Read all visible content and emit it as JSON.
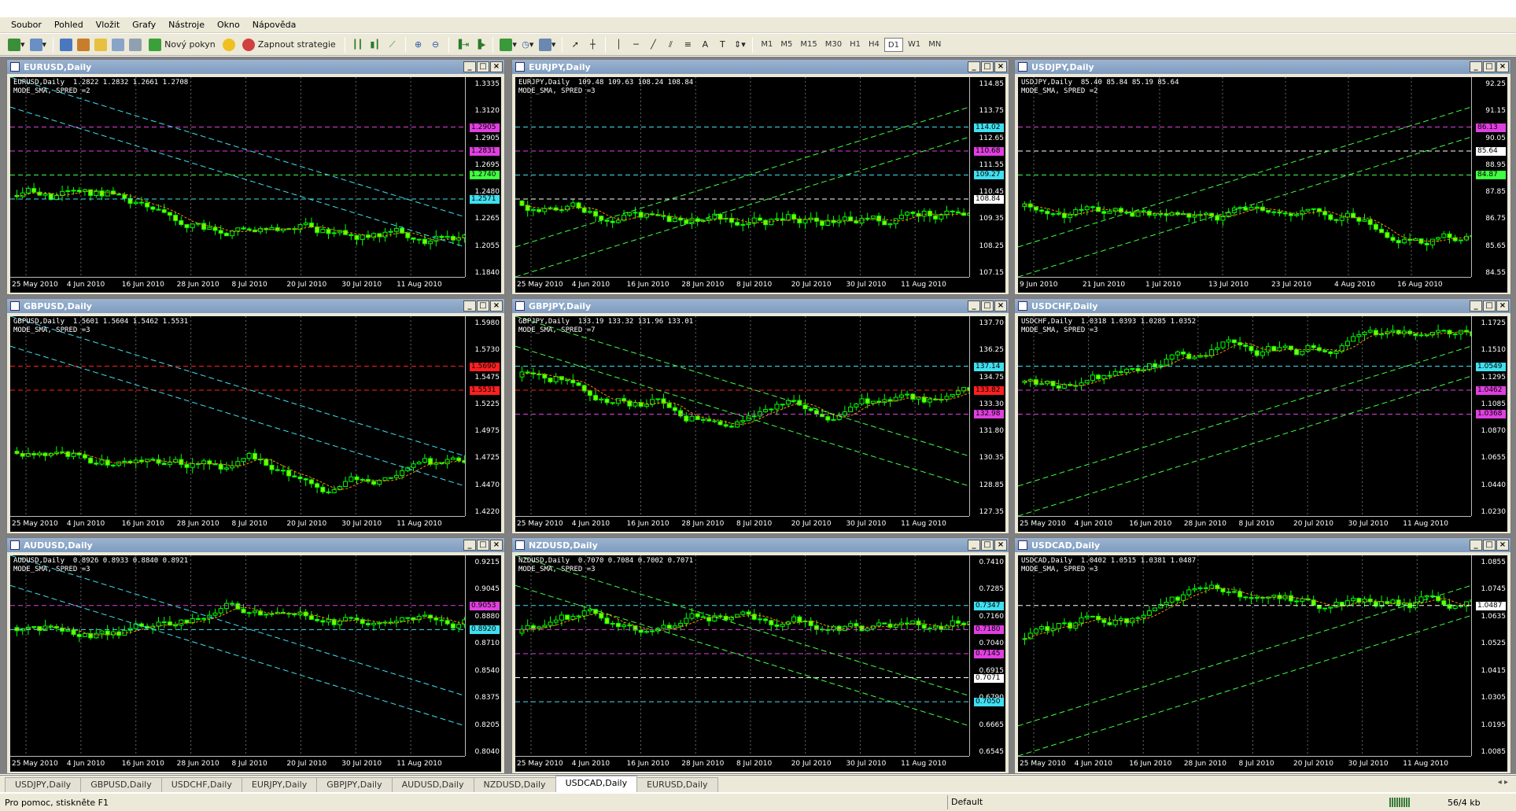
{
  "menu": [
    "Soubor",
    "Pohled",
    "Vložit",
    "Grafy",
    "Nástroje",
    "Okno",
    "Nápověda"
  ],
  "toolbar": {
    "new_order": "Nový pokyn",
    "autotrading": "Zapnout strategie",
    "timeframes": [
      "M1",
      "M5",
      "M15",
      "M30",
      "H1",
      "H4",
      "D1",
      "W1",
      "MN"
    ],
    "active_timeframe": "D1"
  },
  "colors": {
    "bull": "#000000",
    "bear": "#7CFC00",
    "candle_edge": "#00ff00",
    "grid": "#444444",
    "ma": "#ff8c00",
    "cyan": "#40e0f0",
    "magenta": "#e040e0",
    "green": "#40ff40"
  },
  "windows": [
    {
      "title": "EURUSD,Daily",
      "info1": "EURUSD,Daily  1.2822 1.2832 1.2661 1.2708",
      "info2": "MODE_SMA, SPRED =2",
      "prices": [
        "1.3335",
        "1.3120",
        "1.2905",
        "1.2695",
        "1.2480",
        "1.2265",
        "1.2055",
        "1.1840"
      ],
      "labels": [
        {
          "v": "1.2905",
          "c": "#e040e0"
        },
        {
          "v": "1.2831",
          "c": "#e040e0"
        },
        {
          "v": "1.2740",
          "c": "#40ff40"
        },
        {
          "v": "1.2571",
          "c": "#40e0f0"
        }
      ],
      "dates": [
        "25 May 2010",
        "4 Jun 2010",
        "16 Jun 2010",
        "28 Jun 2010",
        "8 Jul 2010",
        "20 Jul 2010",
        "30 Jul 2010",
        "11 Aug 2010"
      ]
    },
    {
      "title": "EURJPY,Daily",
      "info1": "EURJPY,Daily  109.48 109.63 108.24 108.84",
      "info2": "MODE_SMA, SPRED =3",
      "prices": [
        "114.85",
        "113.75",
        "112.65",
        "111.55",
        "110.45",
        "109.35",
        "108.25",
        "107.15"
      ],
      "labels": [
        {
          "v": "114.02",
          "c": "#40e0f0"
        },
        {
          "v": "110.68",
          "c": "#e040e0"
        },
        {
          "v": "109.27",
          "c": "#40e0f0"
        },
        {
          "v": "108.84",
          "c": "#ffffff"
        }
      ],
      "dates": [
        "25 May 2010",
        "4 Jun 2010",
        "16 Jun 2010",
        "28 Jun 2010",
        "8 Jul 2010",
        "20 Jul 2010",
        "30 Jul 2010",
        "11 Aug 2010"
      ]
    },
    {
      "title": "USDJPY,Daily",
      "info1": "USDJPY,Daily  85.40 85.84 85.19 85.64",
      "info2": "MODE_SMA, SPRED =2",
      "prices": [
        "92.25",
        "91.15",
        "90.05",
        "88.95",
        "87.85",
        "86.75",
        "85.65",
        "84.55"
      ],
      "labels": [
        {
          "v": "86.13",
          "c": "#e040e0"
        },
        {
          "v": "85.64",
          "c": "#ffffff"
        },
        {
          "v": "84.87",
          "c": "#40ff40"
        }
      ],
      "dates": [
        "9 Jun 2010",
        "21 Jun 2010",
        "1 Jul 2010",
        "13 Jul 2010",
        "23 Jul 2010",
        "4 Aug 2010",
        "16 Aug 2010"
      ]
    },
    {
      "title": "GBPUSD,Daily",
      "info1": "GBPUSD,Daily  1.5601 1.5604 1.5462 1.5531",
      "info2": "MODE_SMA, SPRED =3",
      "prices": [
        "1.5980",
        "1.5730",
        "1.5475",
        "1.5225",
        "1.4975",
        "1.4725",
        "1.4470",
        "1.4220"
      ],
      "labels": [
        {
          "v": "1.5690",
          "c": "#ff2020"
        },
        {
          "v": "1.5531",
          "c": "#ff2020"
        }
      ],
      "dates": [
        "25 May 2010",
        "4 Jun 2010",
        "16 Jun 2010",
        "28 Jun 2010",
        "8 Jul 2010",
        "20 Jul 2010",
        "30 Jul 2010",
        "11 Aug 2010"
      ]
    },
    {
      "title": "GBPJPY,Daily",
      "info1": "GBPJPY,Daily  133.19 133.32 131.96 133.01",
      "info2": "MODE_SMA, SPRED =7",
      "prices": [
        "137.70",
        "136.25",
        "134.75",
        "133.30",
        "131.80",
        "130.35",
        "128.85",
        "127.35"
      ],
      "labels": [
        {
          "v": "137.14",
          "c": "#40e0f0"
        },
        {
          "v": "133.82",
          "c": "#ff2020"
        },
        {
          "v": "132.98",
          "c": "#e040e0"
        }
      ],
      "dates": [
        "25 May 2010",
        "4 Jun 2010",
        "16 Jun 2010",
        "28 Jun 2010",
        "8 Jul 2010",
        "20 Jul 2010",
        "30 Jul 2010",
        "11 Aug 2010"
      ]
    },
    {
      "title": "USDCHF,Daily",
      "info1": "USDCHF,Daily  1.0318 1.0393 1.0285 1.0352",
      "info2": "MODE_SMA, SPRED =3",
      "prices": [
        "1.1725",
        "1.1510",
        "1.1295",
        "1.1085",
        "1.0870",
        "1.0655",
        "1.0440",
        "1.0230"
      ],
      "labels": [
        {
          "v": "1.0549",
          "c": "#40e0f0"
        },
        {
          "v": "1.0462",
          "c": "#e040e0"
        },
        {
          "v": "1.0368",
          "c": "#e040e0"
        }
      ],
      "dates": [
        "25 May 2010",
        "4 Jun 2010",
        "16 Jun 2010",
        "28 Jun 2010",
        "8 Jul 2010",
        "20 Jul 2010",
        "30 Jul 2010",
        "11 Aug 2010"
      ]
    },
    {
      "title": "AUDUSD,Daily",
      "info1": "AUDUSD,Daily  0.8926 0.8933 0.8840 0.8921",
      "info2": "MODE_SMA, SPRED =3",
      "prices": [
        "0.9215",
        "0.9045",
        "0.8880",
        "0.8710",
        "0.8540",
        "0.8375",
        "0.8205",
        "0.8040"
      ],
      "labels": [
        {
          "v": "0.9053",
          "c": "#e040e0"
        },
        {
          "v": "0.8920",
          "c": "#40e0f0"
        }
      ],
      "dates": [
        "25 May 2010",
        "4 Jun 2010",
        "16 Jun 2010",
        "28 Jun 2010",
        "8 Jul 2010",
        "20 Jul 2010",
        "30 Jul 2010",
        "11 Aug 2010"
      ]
    },
    {
      "title": "NZDUSD,Daily",
      "info1": "NZDUSD,Daily  0.7070 0.7084 0.7002 0.7071",
      "info2": "MODE_SMA, SPRED =3",
      "prices": [
        "0.7410",
        "0.7285",
        "0.7160",
        "0.7040",
        "0.6915",
        "0.6790",
        "0.6665",
        "0.6545"
      ],
      "labels": [
        {
          "v": "0.7347",
          "c": "#40e0f0"
        },
        {
          "v": "0.7180",
          "c": "#e040e0"
        },
        {
          "v": "0.7145",
          "c": "#e040e0"
        },
        {
          "v": "0.7071",
          "c": "#ffffff"
        },
        {
          "v": "0.7050",
          "c": "#40e0f0"
        }
      ],
      "dates": [
        "25 May 2010",
        "4 Jun 2010",
        "16 Jun 2010",
        "28 Jun 2010",
        "8 Jul 2010",
        "20 Jul 2010",
        "30 Jul 2010",
        "11 Aug 2010"
      ]
    },
    {
      "title": "USDCAD,Daily",
      "info1": "USDCAD,Daily  1.0402 1.0515 1.0381 1.0487",
      "info2": "MODE_SMA, SPRED =3",
      "prices": [
        "1.0855",
        "1.0745",
        "1.0635",
        "1.0525",
        "1.0415",
        "1.0305",
        "1.0195",
        "1.0085"
      ],
      "labels": [
        {
          "v": "1.0487",
          "c": "#ffffff"
        }
      ],
      "dates": [
        "25 May 2010",
        "4 Jun 2010",
        "16 Jun 2010",
        "28 Jun 2010",
        "8 Jul 2010",
        "20 Jul 2010",
        "30 Jul 2010",
        "11 Aug 2010"
      ]
    }
  ],
  "tabs": [
    "USDJPY,Daily",
    "GBPUSD,Daily",
    "USDCHF,Daily",
    "EURJPY,Daily",
    "GBPJPY,Daily",
    "AUDUSD,Daily",
    "NZDUSD,Daily",
    "USDCAD,Daily",
    "EURUSD,Daily"
  ],
  "active_tab": "USDCAD,Daily",
  "status": {
    "help": "Pro pomoc, stiskněte F1",
    "profile": "Default",
    "traffic": "56/4 kb"
  }
}
